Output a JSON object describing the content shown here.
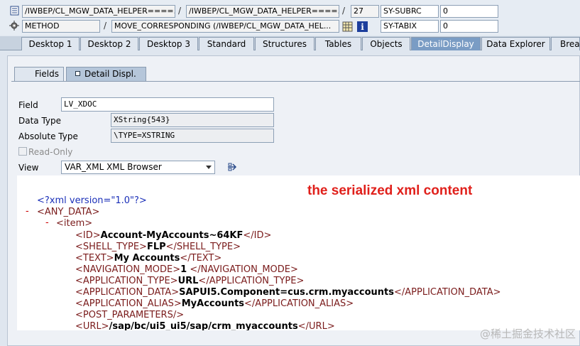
{
  "top": {
    "row1": {
      "program": "/IWBEP/CL_MGW_DATA_HELPER====...",
      "include": "/IWBEP/CL_MGW_DATA_HELPER====...",
      "line": "27",
      "var_name": "SY-SUBRC",
      "var_value": "0"
    },
    "row2": {
      "event_type": "METHOD",
      "event": "MOVE_CORRESPONDING (/IWBEP/CL_MGW_DATA_HEL...",
      "var_name": "SY-TABIX",
      "var_value": "0"
    },
    "separator": "/"
  },
  "tabs": [
    "Desktop 1",
    "Desktop 2",
    "Desktop 3",
    "Standard",
    "Structures",
    "Tables",
    "Objects",
    "DetailDisplay",
    "Data Explorer",
    "Break"
  ],
  "active_tab": "DetailDisplay",
  "subtabs": {
    "fields": "Fields",
    "detail": "Detail Displ."
  },
  "detail": {
    "field_label": "Field",
    "field_value": "LV_XDOC",
    "datatype_label": "Data Type",
    "datatype_value": "XString{543}",
    "abstype_label": "Absolute Type",
    "abstype_value": "\\TYPE=XSTRING",
    "readonly_label": "Read-Only",
    "view_label": "View",
    "view_value": "VAR_XML XML Browser"
  },
  "annotation": "the serialized xml content",
  "xml": {
    "decl": "<?xml version=\"1.0\"?>",
    "minus": "-",
    "any_data_open": "<ANY_DATA>",
    "item_open": "<item>",
    "lines": [
      {
        "open": "<ID>",
        "value": "Account-MyAccounts~64KF",
        "close": "</ID>"
      },
      {
        "open": "<SHELL_TYPE>",
        "value": "FLP",
        "close": "</SHELL_TYPE>"
      },
      {
        "open": "<TEXT>",
        "value": "My Accounts",
        "close": "</TEXT>"
      },
      {
        "open": "<NAVIGATION_MODE>",
        "value": "1",
        "close": " </NAVIGATION_MODE>"
      },
      {
        "open": "<APPLICATION_TYPE>",
        "value": "URL",
        "close": "</APPLICATION_TYPE>"
      },
      {
        "open": "<APPLICATION_DATA>",
        "value": "SAPUI5.Component=cus.crm.myaccounts",
        "close": "</APPLICATION_DATA>"
      },
      {
        "open": "<APPLICATION_ALIAS>",
        "value": "MyAccounts",
        "close": "</APPLICATION_ALIAS>"
      },
      {
        "open": "<POST_PARAMETERS/>",
        "value": "",
        "close": ""
      },
      {
        "open": "<URL>",
        "value": "/sap/bc/ui5_ui5/sap/crm_myaccounts",
        "close": "</URL>"
      }
    ]
  },
  "watermark": "@稀土掘金技术社区"
}
